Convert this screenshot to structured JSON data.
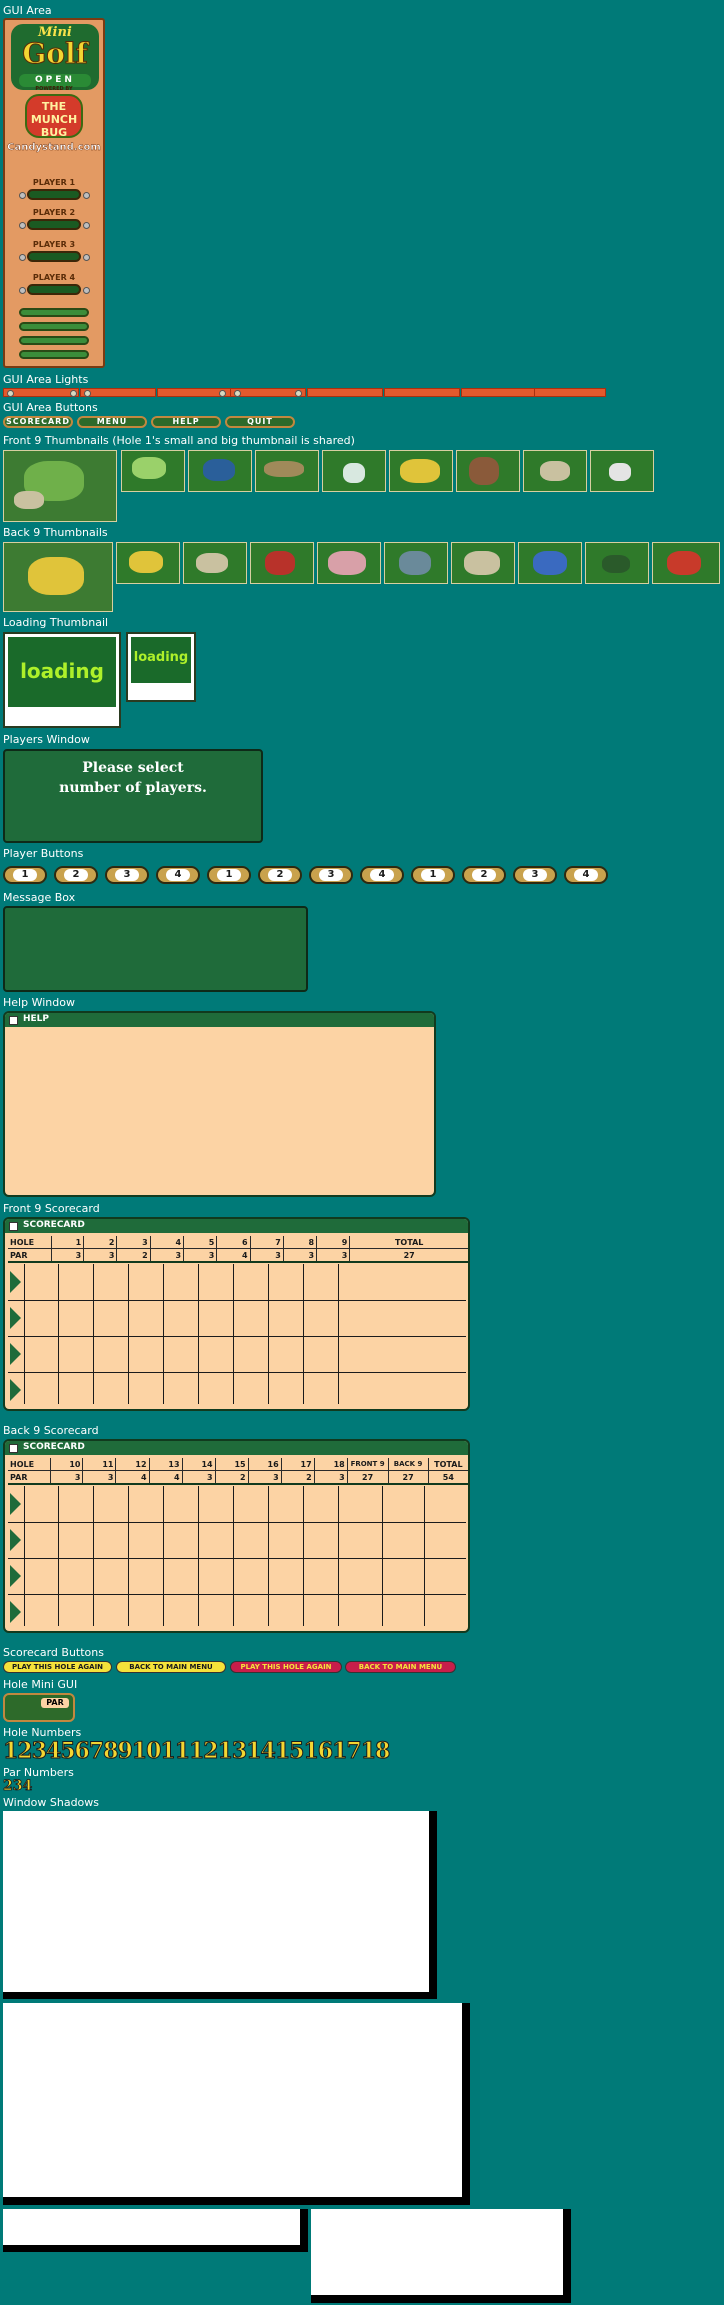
{
  "sections": {
    "gui_area": "GUI Area",
    "gui_lights": "GUI Area Lights",
    "gui_buttons": "GUI Area Buttons",
    "front9_thumbs": "Front 9 Thumbnails (Hole 1's small and big thumbnail is shared)",
    "back9_thumbs": "Back 9 Thumbnails",
    "loading_thumb": "Loading Thumbnail",
    "players_window": "Players Window",
    "player_buttons": "Player Buttons",
    "message_box": "Message Box",
    "help_window": "Help Window",
    "front9_scorecard": "Front 9 Scorecard",
    "back9_scorecard": "Back 9 Scorecard",
    "scorecard_buttons": "Scorecard Buttons",
    "hole_mini_gui": "Hole Mini GUI",
    "hole_numbers": "Hole Numbers",
    "par_numbers": "Par Numbers",
    "window_shadows": "Window Shadows"
  },
  "gui": {
    "logo_mini": "Mini",
    "logo_golf": "Golf",
    "logo_open": "OPEN",
    "powered_by": "POWERED BY",
    "sponsor": "THE MUNCH BUG",
    "site": "Candystand.com",
    "players": [
      "PLAYER 1",
      "PLAYER 2",
      "PLAYER 3",
      "PLAYER 4"
    ]
  },
  "gui_buttons": [
    "SCORECARD",
    "MENU",
    "HELP",
    "QUIT"
  ],
  "loading": {
    "big": "loading",
    "small": "loading"
  },
  "players_window_text": "Please select\nnumber of players.",
  "player_buttons": [
    "1",
    "2",
    "3",
    "4",
    "1",
    "2",
    "3",
    "4",
    "1",
    "2",
    "3",
    "4"
  ],
  "help_title": "HELP",
  "front9": {
    "title": "SCORECARD",
    "header": [
      "HOLE",
      "1",
      "2",
      "3",
      "4",
      "5",
      "6",
      "7",
      "8",
      "9",
      "TOTAL"
    ],
    "par": [
      "PAR",
      "3",
      "3",
      "2",
      "3",
      "3",
      "4",
      "3",
      "3",
      "3",
      "27"
    ]
  },
  "back9": {
    "title": "SCORECARD",
    "header": [
      "HOLE",
      "10",
      "11",
      "12",
      "13",
      "14",
      "15",
      "16",
      "17",
      "18",
      "FRONT 9",
      "BACK 9",
      "TOTAL"
    ],
    "par": [
      "PAR",
      "3",
      "3",
      "4",
      "4",
      "3",
      "2",
      "3",
      "2",
      "3",
      "27",
      "27",
      "54"
    ]
  },
  "scorecard_buttons": [
    "PLAY THIS HOLE AGAIN",
    "BACK TO MAIN MENU",
    "PLAY THIS HOLE AGAIN",
    "BACK TO MAIN MENU"
  ],
  "hole_mini_par": "PAR",
  "hole_numbers": "123456789101112131415161718",
  "par_numbers": "234"
}
